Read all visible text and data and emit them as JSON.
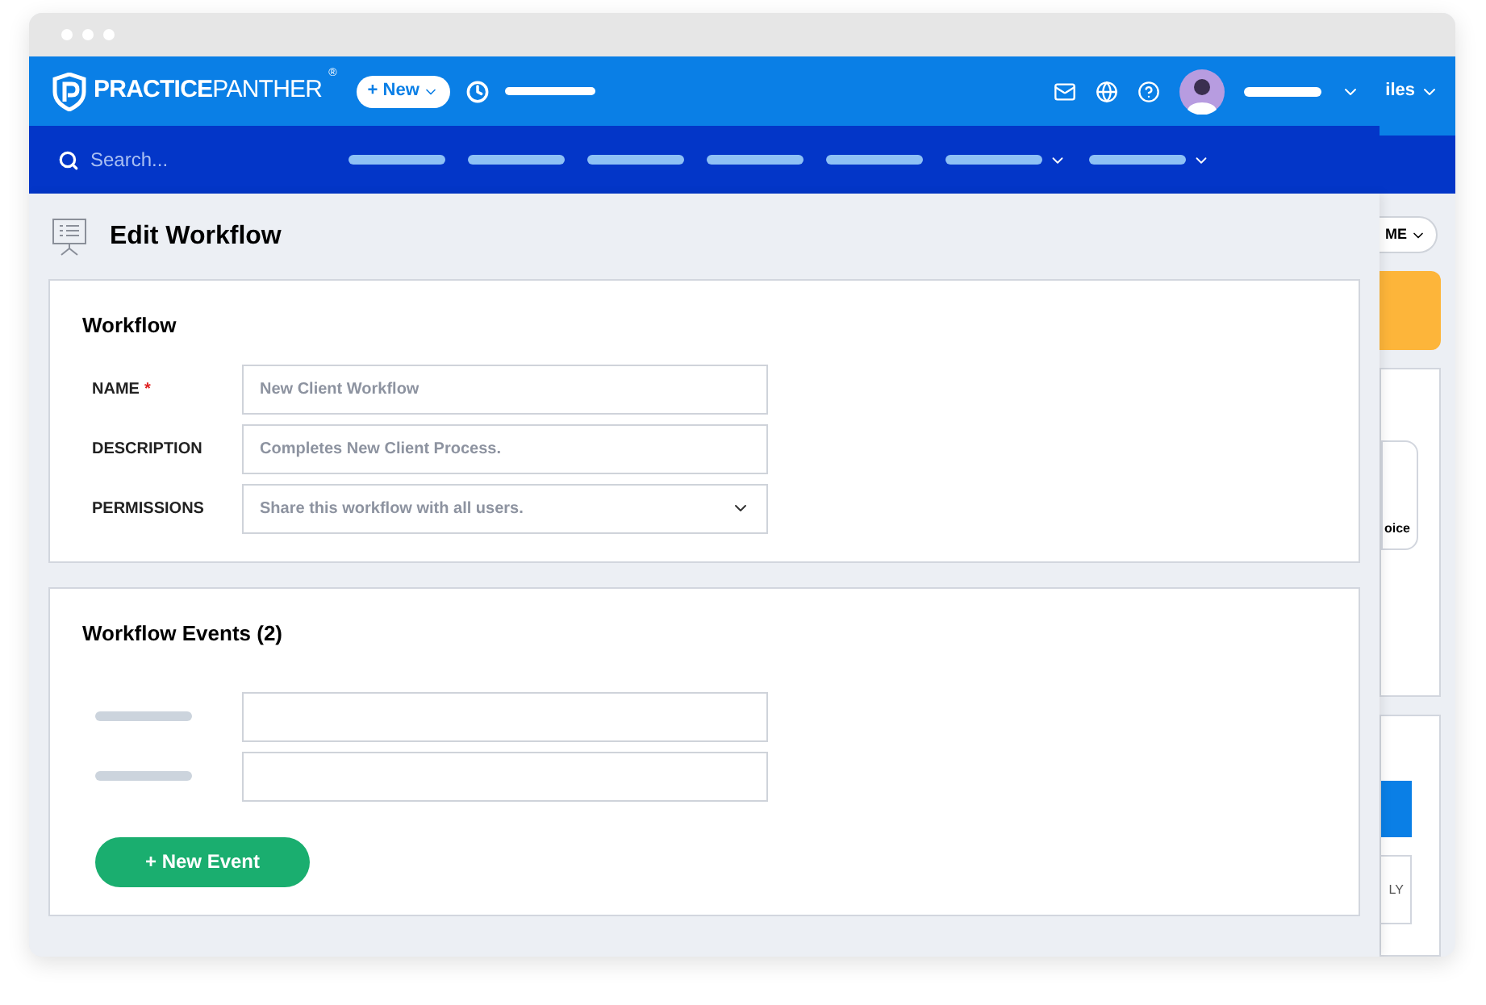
{
  "header": {
    "brand": "**PRACTICE**PANTHER",
    "brand_mark": "®",
    "new_button": "+ New",
    "menu_label": "iles"
  },
  "nav": {
    "search_placeholder": "Search...",
    "items": [
      {
        "dropdown": false
      },
      {
        "dropdown": false
      },
      {
        "dropdown": false
      },
      {
        "dropdown": false
      },
      {
        "dropdown": false
      },
      {
        "dropdown": true
      },
      {
        "dropdown": true
      }
    ]
  },
  "panel": {
    "title": "Edit Workflow",
    "workflow": {
      "title": "Workflow",
      "fields": [
        {
          "label": "NAME",
          "required_mark": "*",
          "kind": "text",
          "placeholder": "New Client Workflow"
        },
        {
          "label": "DESCRIPTION",
          "kind": "text",
          "placeholder": "Completes New Client Process."
        },
        {
          "label": "PERMISSIONS",
          "kind": "select",
          "value": "Share this workflow with all users."
        }
      ]
    },
    "events": {
      "title": "Workflow Events (2)",
      "rows": [
        {
          "kind": "blank"
        },
        {
          "kind": "blank"
        }
      ],
      "button": "+ New Event"
    }
  },
  "background": {
    "pill_button": "ME",
    "tile_label": "oice",
    "column_header": "LY"
  }
}
